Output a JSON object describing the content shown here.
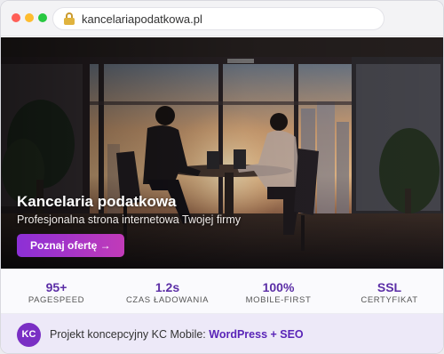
{
  "browser": {
    "url": "kancelariapodatkowa.pl"
  },
  "hero": {
    "title": "Kancelaria podatkowa",
    "subtitle": "Profesjonalna strona internetowa Twojej firmy",
    "cta_label": "Poznaj ofertę →",
    "cta_gradient": [
      "#8c2fd6",
      "#c13bb8"
    ]
  },
  "stats": [
    {
      "value": "95+",
      "label": "PAGESPEED"
    },
    {
      "value": "1.2s",
      "label": "CZAS ŁADOWANIA"
    },
    {
      "value": "100%",
      "label": "MOBILE-FIRST"
    },
    {
      "value": "SSL",
      "label": "CERTYFIKAT"
    }
  ],
  "footer": {
    "badge": "KC",
    "text": "Projekt koncepcyjny KC Mobile: ",
    "highlight": "WordPress + SEO"
  },
  "colors": {
    "accent": "#5b2ea6",
    "badge_bg": "#7a2fc4",
    "footer_bg": "#ede9f8"
  }
}
